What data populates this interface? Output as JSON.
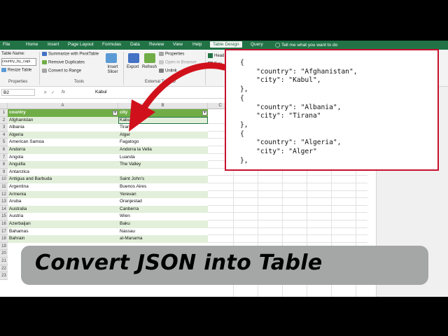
{
  "ribbon_tabs": [
    "File",
    "Home",
    "Insert",
    "Page Layout",
    "Formulas",
    "Data",
    "Review",
    "View",
    "Help",
    "Table Design",
    "Query"
  ],
  "active_tab": "Table Design",
  "tell_me": "Tell me what you want to do",
  "ribbon": {
    "table_name_label": "Table Name:",
    "table_name_value": "country_by_capi",
    "resize_table": "Resize Table",
    "properties_group": "Properties",
    "summarize_pivot": "Summarize with PivotTable",
    "remove_duplicates": "Remove Duplicates",
    "convert_range": "Convert to Range",
    "tools_group": "Tools",
    "insert_slicer": "Insert Slicer",
    "export": "Export",
    "refresh": "Refresh",
    "properties_btn": "Properties",
    "open_browser": "Open in Browser",
    "unlink": "Unlink",
    "external_group": "External Table D",
    "header_row": "Head",
    "total_row": "Tota"
  },
  "formula_bar": {
    "name_box": "B2",
    "fx": "fx",
    "value": "Kabul"
  },
  "columns": [
    "A",
    "B",
    "C"
  ],
  "table_headers": [
    "country",
    "city"
  ],
  "rows": [
    {
      "n": "2",
      "country": "Afghanistan",
      "city": "Kabul"
    },
    {
      "n": "3",
      "country": "Albania",
      "city": "Tirana"
    },
    {
      "n": "4",
      "country": "Algeria",
      "city": "Alger"
    },
    {
      "n": "5",
      "country": "American Samoa",
      "city": "Fagatogo"
    },
    {
      "n": "6",
      "country": "Andorra",
      "city": "Andorra la Vella"
    },
    {
      "n": "7",
      "country": "Angola",
      "city": "Luanda"
    },
    {
      "n": "8",
      "country": "Anguilla",
      "city": "The Valley"
    },
    {
      "n": "9",
      "country": "Antarctica",
      "city": ""
    },
    {
      "n": "10",
      "country": "Antigua and Barbuda",
      "city": "Saint John's"
    },
    {
      "n": "11",
      "country": "Argentina",
      "city": "Buenos Aires"
    },
    {
      "n": "12",
      "country": "Armenia",
      "city": "Yerevan"
    },
    {
      "n": "13",
      "country": "Aruba",
      "city": "Oranjestad"
    },
    {
      "n": "14",
      "country": "Australia",
      "city": "Canberra"
    },
    {
      "n": "15",
      "country": "Austria",
      "city": "Wien"
    },
    {
      "n": "16",
      "country": "Azerbaijan",
      "city": "Baku"
    },
    {
      "n": "17",
      "country": "Bahamas",
      "city": "Nassau"
    },
    {
      "n": "18",
      "country": "Bahrain",
      "city": "al-Manama"
    },
    {
      "n": "19",
      "country": "",
      "city": ""
    }
  ],
  "json_lines": [
    "{",
    "    \"country\": \"Afghanistan\",",
    "    \"city\": \"Kabul\",",
    "},",
    "{",
    "    \"country\": \"Albania\",",
    "    \"city\": \"Tirana\"",
    "},",
    "{",
    "    \"country\": \"Algeria\",",
    "    \"city\": \"Alger\"",
    "},"
  ],
  "banner_title": "Convert JSON into Table",
  "colors": {
    "excel_green": "#217346",
    "table_header": "#70ad47",
    "band": "#e2efda",
    "popup_border": "#c8102e",
    "arrow": "#d0111b"
  }
}
